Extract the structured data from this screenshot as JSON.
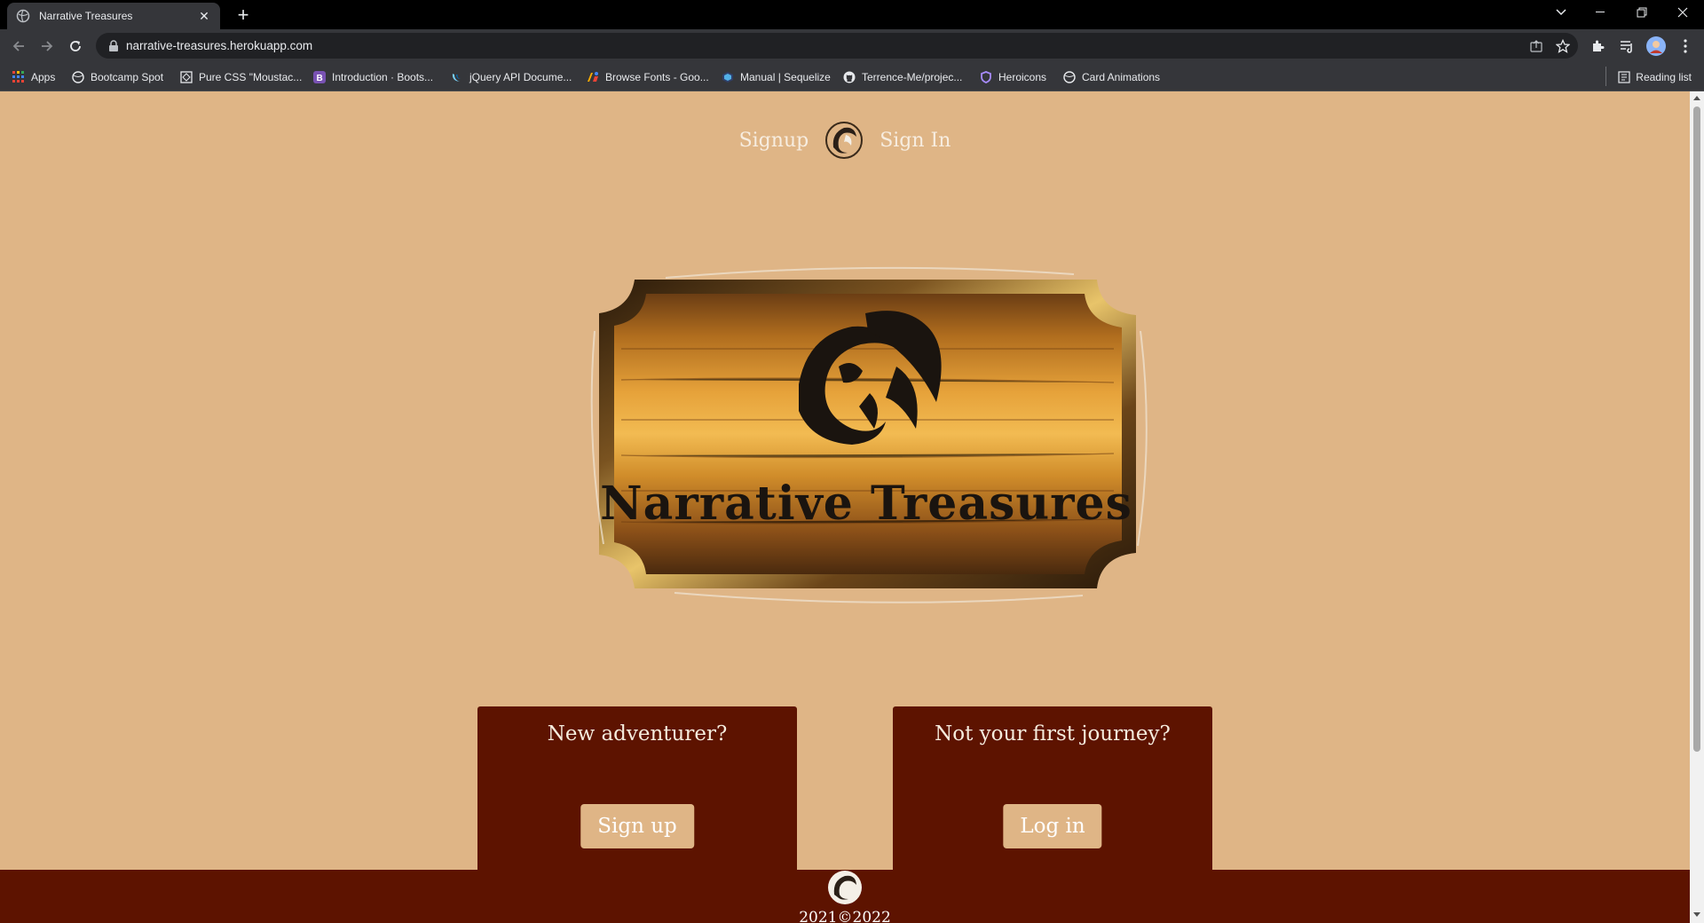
{
  "browser": {
    "tab": {
      "title": "Narrative Treasures"
    },
    "url": "narrative-treasures.herokuapp.com",
    "bookmarks": [
      {
        "label": "Apps",
        "icon": "apps-grid-icon"
      },
      {
        "label": "Bootcamp Spot",
        "icon": "globe-icon"
      },
      {
        "label": "Pure CSS \"Moustac...",
        "icon": "codepen-icon"
      },
      {
        "label": "Introduction · Boots...",
        "icon": "bootstrap-icon"
      },
      {
        "label": "jQuery API Docume...",
        "icon": "jquery-icon"
      },
      {
        "label": "Browse Fonts - Goo...",
        "icon": "google-fonts-icon"
      },
      {
        "label": "Manual | Sequelize",
        "icon": "sequelize-icon"
      },
      {
        "label": "Terrence-Me/projec...",
        "icon": "github-icon"
      },
      {
        "label": "Heroicons",
        "icon": "heroicons-icon"
      },
      {
        "label": "Card Animations",
        "icon": "globe-icon"
      }
    ],
    "reading_list": "Reading list"
  },
  "nav": {
    "signup": "Signup",
    "signin": "Sign In"
  },
  "hero": {
    "sign_text": "Narrative Treasures"
  },
  "cards": [
    {
      "heading": "New adventurer?",
      "button": "Sign up"
    },
    {
      "heading": "Not your first journey?",
      "button": "Log in"
    }
  ],
  "footer": {
    "copyright": "2021©2022"
  },
  "colors": {
    "page_bg": "#dfb586",
    "card_bg": "#5d1300",
    "footer_bg": "#5d1300"
  }
}
